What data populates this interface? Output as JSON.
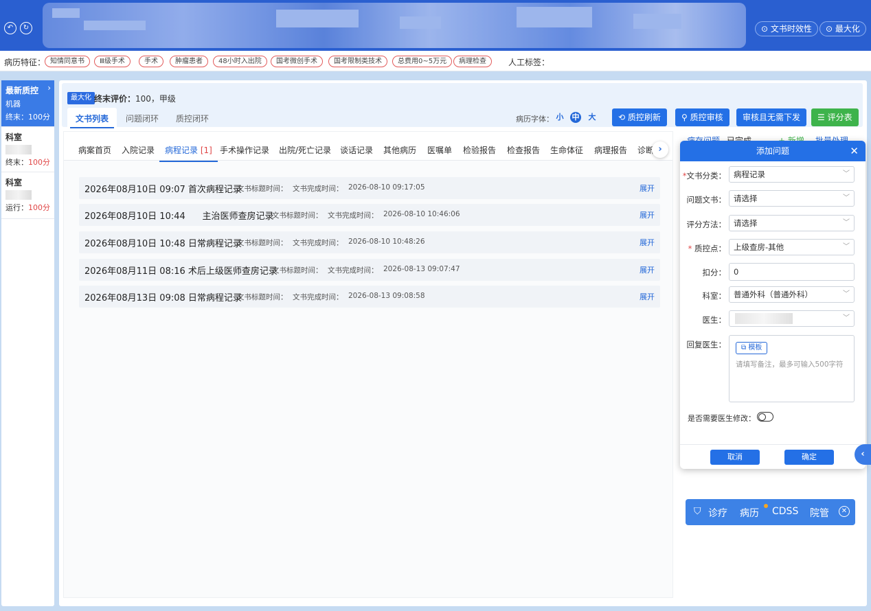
{
  "header": {
    "btn_timeliness": "文书时效性",
    "btn_maximize": "最大化"
  },
  "features": {
    "label": "病历特征：",
    "chips": [
      "知情同意书",
      "Ⅲ级手术",
      "手术",
      "肿瘤患者",
      "48小时入出院",
      "国考微创手术",
      "国考限制类技术",
      "总费用0~5万元",
      "病理检查"
    ],
    "manual_label": "人工标签："
  },
  "left_list": [
    {
      "title": "最新质控",
      "sub": "机器",
      "score_label": "终末：",
      "score": "100分"
    },
    {
      "title": "科室",
      "score_label": "终末：",
      "score": "100分"
    },
    {
      "title": "科室",
      "score_label": "运行：",
      "score": "100分"
    }
  ],
  "main": {
    "badge": "最大化",
    "final_eval_label": "终末评价：",
    "final_eval_value": "100，甲级",
    "tabs": [
      "文书列表",
      "问题闭环",
      "质控闭环"
    ],
    "font_label": "病历字体：",
    "font_sizes": [
      "小",
      "中",
      "大"
    ],
    "buttons": [
      "质控刷新",
      "质控审核",
      "审核且无需下发",
      "评分表"
    ]
  },
  "subtabs": [
    "病案首页",
    "入院记录",
    "病程记录",
    "手术操作记录",
    "出院/死亡记录",
    "谈话记录",
    "其他病历",
    "医嘱单",
    "检验报告",
    "检查报告",
    "生命体征",
    "病理报告",
    "诊断"
  ],
  "subtab_count": "[1]",
  "records": [
    {
      "title": "2026年08月10日 09:07 首次病程记录",
      "meta1": "文书标题时间：",
      "meta2": "文书完成时间：",
      "done": "2026-08-10 09:17:05",
      "expand": "展开"
    },
    {
      "title": "2026年08月10日 10:44      主治医师查房记录",
      "meta1": "文书标题时间：",
      "meta2": "文书完成时间：",
      "done": "2026-08-10 10:46:06",
      "expand": "展开"
    },
    {
      "title": "2026年08月10日 10:48 日常病程记录",
      "meta1": "文书标题时间：",
      "meta2": "文书完成时间：",
      "done": "2026-08-10 10:48:26",
      "expand": "展开"
    },
    {
      "title": "2026年08月11日 08:16 术后上级医师查房记录",
      "meta1": "文书标题时间：",
      "meta2": "文书完成时间：",
      "done": "2026-08-13 09:07:47",
      "expand": "展开"
    },
    {
      "title": "2026年08月13日 09:08 日常病程记录",
      "meta1": "文书标题时间：",
      "meta2": "文书完成时间：",
      "done": "2026-08-13 09:08:58",
      "expand": "展开"
    }
  ],
  "right_col": {
    "tab1": "病存问题",
    "tab2": "已完成",
    "add": "+ 新增",
    "batch": "批量处理"
  },
  "dialog": {
    "title": "添加问题",
    "fields": [
      {
        "label": "文书分类：",
        "required": true,
        "value": "病程记录"
      },
      {
        "label": "问题文书：",
        "required": false,
        "value": "请选择"
      },
      {
        "label": "评分方法：",
        "required": false,
        "value": "请选择"
      },
      {
        "label": "质控点：",
        "required": true,
        "value": "上级查房-其他"
      },
      {
        "label": "扣分：",
        "required": false,
        "value": "0"
      },
      {
        "label": "科室：",
        "required": false,
        "value": "普通外科（普通外科）"
      },
      {
        "label": "医生：",
        "required": false,
        "value": ""
      }
    ],
    "reply_label": "回复医生：",
    "template_btn": "模板",
    "reply_placeholder": "请填写备注，最多可输入500字符",
    "toggle_label": "是否需要医生修改：",
    "cancel": "取消",
    "confirm": "确定"
  },
  "cdss": {
    "items": [
      "诊疗",
      "病历",
      "CDSS",
      "院管"
    ]
  }
}
